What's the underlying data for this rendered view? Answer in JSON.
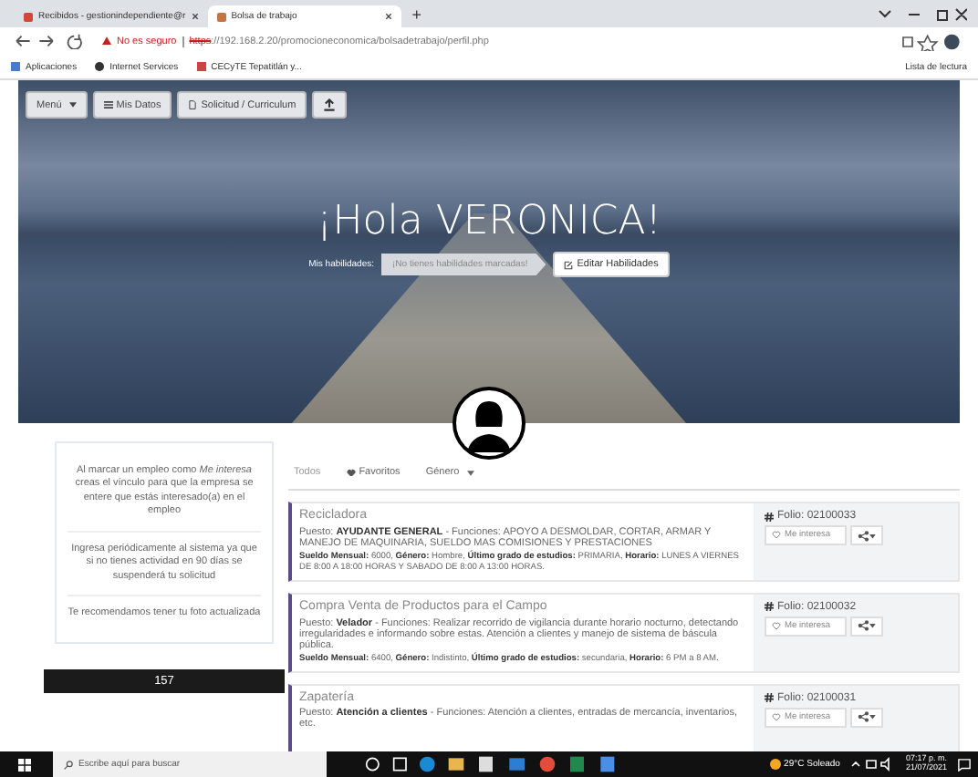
{
  "browser": {
    "tabs": [
      {
        "title": "Recibidos - gestionindependiente@r",
        "selected": false
      },
      {
        "title": "Bolsa de trabajo",
        "selected": true
      }
    ],
    "new_tab": "+",
    "security": "No es seguro",
    "url_scheme": "https",
    "url_rest": "://192.168.2.20/promocioneconomica/bolsadetrabajo/perfil.php",
    "bookmarks": [
      "Aplicaciones",
      "Internet Services",
      "CECyTE Tepatitlán y..."
    ],
    "reading_list": "Lista de lectura"
  },
  "nav": [
    {
      "label": "Menú",
      "kind": "dropdown"
    },
    {
      "label": "Mis Datos",
      "kind": "list"
    },
    {
      "label": "Solicitud / Curriculum",
      "kind": "doc"
    },
    {
      "kind": "upload"
    }
  ],
  "greeting": "¡Hola VERONICA!",
  "skills": {
    "label": "Mis habilidades:",
    "tag": "¡No tienes habilidades marcadas!",
    "button": "Editar Habilidades"
  },
  "tips": [
    "Al marcar un empleo como *Me interesa* creas el vínculo para que la empresa se entere que estás interesado(a) en el empleo",
    "Ingresa periódicamente al sistema ya que si no tienes actividad en 90 días se suspenderá tu solicitud",
    "Te recomendamos tener tu foto actualizada"
  ],
  "counter": "157",
  "filters": [
    {
      "label": "Todos",
      "kind": "plain",
      "selected": true
    },
    {
      "label": "Favoritos",
      "kind": "heart",
      "selected": false
    },
    {
      "label": "Género",
      "kind": "dropdown",
      "selected": false
    }
  ],
  "jobs": [
    {
      "company": "Recicladora",
      "description": "Puesto: **AYUDANTE GENERAL** - Funciones: APOYO A DESMOLDAR, CORTAR, ARMAR Y MANEJO DE MAQUINARIA, SUELDO MAS COMISIONES Y PRESTACIONES",
      "details": "**Sueldo Mensual:** 6000, **Género:** Hombre, **Último grado de estudios:** PRIMARIA, **Horario:** LUNES A VIERNES DE 8:00 A 18:00 HORAS Y SABADO DE 8:00 A 13:00 HORAS.",
      "folio": "Folio: 02100033",
      "interest": "Me interesa"
    },
    {
      "company": "Compra Venta de Productos para el Campo",
      "description": "Puesto: **Velador** - Funciones: Realizar recorrido de vigilancia durante horario nocturno, detectando irregularidades e informando sobre estas. Atención a clientes y manejo de sistema de báscula pública.",
      "details": "**Sueldo Mensual:** 6400, **Género:** Indistinto, **Último grado de estudios:** secundaria, **Horario:** 6 PM a 8 AM.",
      "folio": "Folio: 02100032",
      "interest": "Me interesa"
    },
    {
      "company": "Zapatería",
      "description": "Puesto: **Atención a clientes** - Funciones: Atención a clientes, entradas de mercancía, inventarios, etc.",
      "folio": "Folio: 02100031",
      "interest": "Me interesa"
    }
  ],
  "taskbar": {
    "search": "Escribe aquí para buscar",
    "weather": "29°C Soleado",
    "time": "07:17 p. m.",
    "date": "21/07/2021"
  }
}
